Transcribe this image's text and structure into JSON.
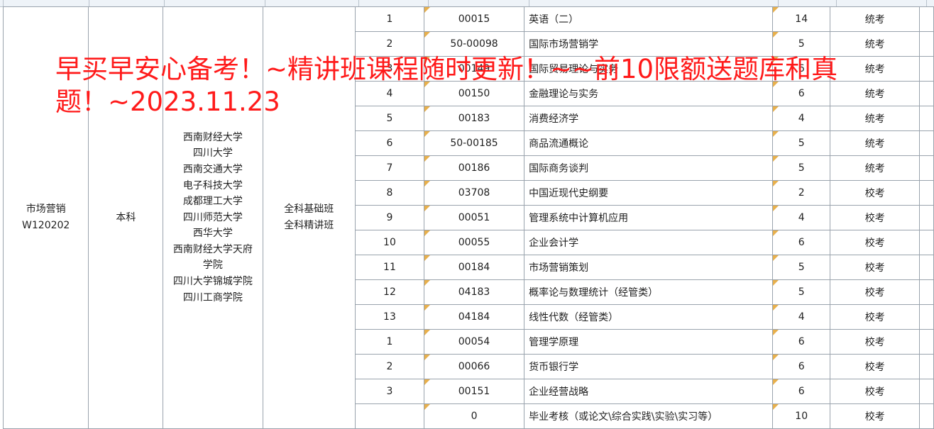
{
  "major": {
    "name": "市场营销",
    "code": "W120202"
  },
  "level": "本科",
  "schools": [
    "西南财经大学",
    "四川大学",
    "西南交通大学",
    "电子科技大学",
    "成都理工大学",
    "四川师范大学",
    "西华大学",
    "西南财经大学天府",
    "学院",
    "四川大学锦城学院",
    "四川工商学院"
  ],
  "class_types": [
    "全科基础班",
    "全科精讲班"
  ],
  "courses": [
    {
      "no": "1",
      "code": "00015",
      "name": "英语（二）",
      "credit": "14",
      "exam": "统考"
    },
    {
      "no": "2",
      "code": "50-00098",
      "name": "国际市场营销学",
      "credit": "5",
      "exam": "统考"
    },
    {
      "no": "3",
      "code": "00149",
      "name": "国际贸易理论与实务",
      "credit": "6",
      "exam": "统考"
    },
    {
      "no": "4",
      "code": "00150",
      "name": "金融理论与实务",
      "credit": "6",
      "exam": "统考"
    },
    {
      "no": "5",
      "code": "00183",
      "name": "消费经济学",
      "credit": "4",
      "exam": "统考"
    },
    {
      "no": "6",
      "code": "50-00185",
      "name": "商品流通概论",
      "credit": "5",
      "exam": "统考"
    },
    {
      "no": "7",
      "code": "00186",
      "name": "国际商务谈判",
      "credit": "5",
      "exam": "统考"
    },
    {
      "no": "8",
      "code": "03708",
      "name": "中国近现代史纲要",
      "credit": "2",
      "exam": "校考"
    },
    {
      "no": "9",
      "code": "00051",
      "name": "管理系统中计算机应用",
      "credit": "4",
      "exam": "校考"
    },
    {
      "no": "10",
      "code": "00055",
      "name": "企业会计学",
      "credit": "6",
      "exam": "校考"
    },
    {
      "no": "11",
      "code": "00184",
      "name": "市场营销策划",
      "credit": "5",
      "exam": "校考"
    },
    {
      "no": "12",
      "code": "04183",
      "name": "概率论与数理统计（经管类）",
      "credit": "5",
      "exam": "校考"
    },
    {
      "no": "13",
      "code": "04184",
      "name": "线性代数（经管类）",
      "credit": "4",
      "exam": "校考"
    },
    {
      "no": "1",
      "code": "00054",
      "name": "管理学原理",
      "credit": "6",
      "exam": "校考"
    },
    {
      "no": "2",
      "code": "00066",
      "name": "货币银行学",
      "credit": "6",
      "exam": "校考"
    },
    {
      "no": "3",
      "code": "00151",
      "name": "企业经营战略",
      "credit": "6",
      "exam": "校考"
    },
    {
      "no": "",
      "code": "0",
      "name": "毕业考核（或论文\\综合实践\\实验\\实习等）",
      "credit": "10",
      "exam": "校考"
    }
  ],
  "banner": {
    "line1": "早买早安心备考！~精讲班课程随时更新！~~前10限额送题库和真",
    "line2": "题！~2023.11.23"
  },
  "colors": {
    "banner": "#ff1a1a",
    "grid": "#9aa3ad",
    "note_marker": "#e8b04c"
  }
}
